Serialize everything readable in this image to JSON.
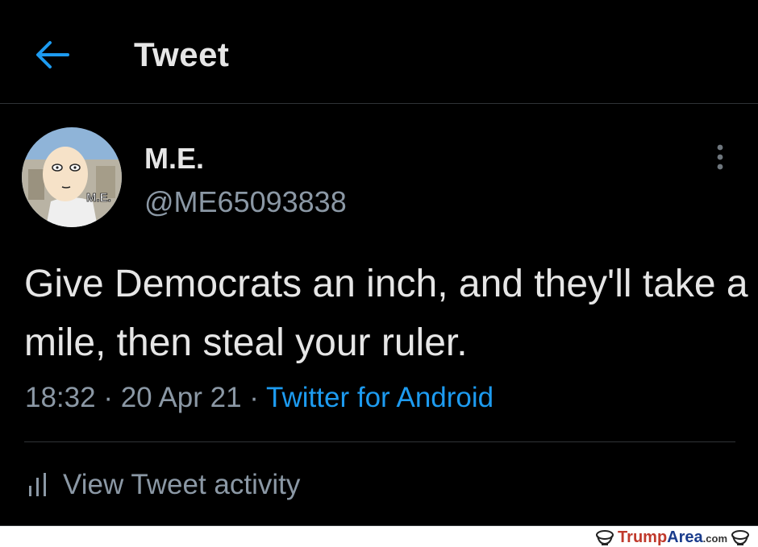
{
  "header": {
    "title": "Tweet",
    "back_icon": "arrow-left-icon"
  },
  "tweet": {
    "display_name": "M.E.",
    "handle": "@ME65093838",
    "avatar_label": "M.E.",
    "text": "Give Democrats an inch, and they'll take a mile, then steal your ruler.",
    "time": "18:32",
    "date": "20 Apr 21",
    "source": "Twitter for Android",
    "separator": "·"
  },
  "actions": {
    "activity_label": "View Tweet activity",
    "activity_icon": "bar-chart-icon",
    "more_icon": "vertical-dots-icon"
  },
  "watermark": {
    "part1": "Trump",
    "part2": "Area",
    "part3": ".com"
  },
  "colors": {
    "background": "#000000",
    "text_primary": "#e6e6e6",
    "text_secondary": "#8b98a5",
    "accent": "#1d9bf0",
    "divider": "#2f3336"
  }
}
